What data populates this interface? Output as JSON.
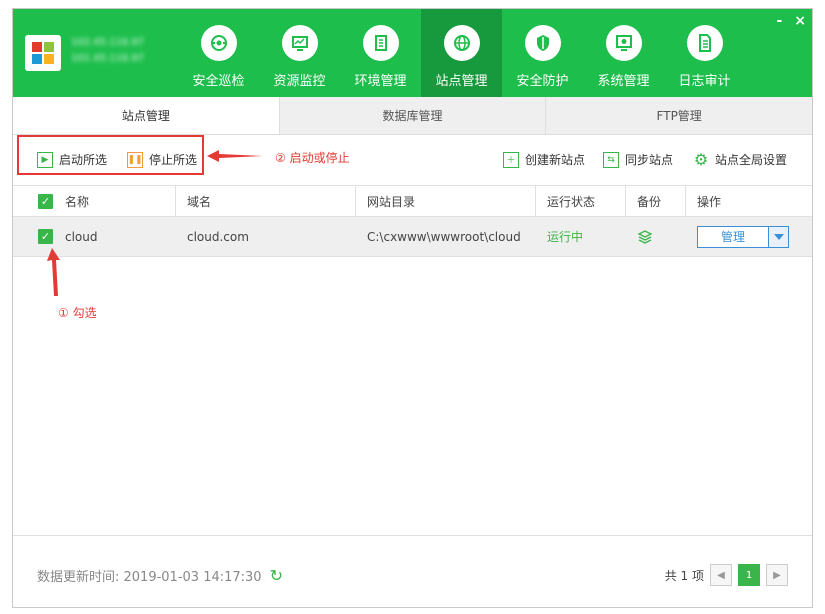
{
  "window": {
    "minimize_label": "-",
    "close_label": "×",
    "server_lines": [
      "102.45.116.97",
      "101.45.116.97"
    ]
  },
  "nav": [
    {
      "label": "安全巡检",
      "icon": "shield-scan-icon"
    },
    {
      "label": "资源监控",
      "icon": "monitor-chart-icon"
    },
    {
      "label": "环境管理",
      "icon": "server-stack-icon"
    },
    {
      "label": "站点管理",
      "icon": "globe-icon",
      "active": true
    },
    {
      "label": "安全防护",
      "icon": "shield-icon"
    },
    {
      "label": "系统管理",
      "icon": "gear-screen-icon"
    },
    {
      "label": "日志审计",
      "icon": "document-icon"
    }
  ],
  "tabs": [
    "站点管理",
    "数据库管理",
    "FTP管理"
  ],
  "toolbar": {
    "start_selected": "启动所选",
    "stop_selected": "停止所选",
    "create_site": "创建新站点",
    "sync_sites": "同步站点",
    "global_settings": "站点全局设置"
  },
  "annotations": {
    "step2": "② 启动或停止",
    "step1": "① 勾选"
  },
  "table": {
    "headers": [
      "名称",
      "域名",
      "网站目录",
      "运行状态",
      "备份",
      "操作"
    ],
    "rows": [
      {
        "name": "cloud",
        "domain": "cloud.com",
        "dir": "C:\\cxwww\\wwwroot\\cloud",
        "status": "运行中",
        "action": "管理"
      }
    ]
  },
  "footer": {
    "update_time": "数据更新时间: 2019-01-03 14:17:30",
    "total": "共 1 项",
    "current_page": "1"
  },
  "colors": {
    "brand_green": "#1dbe4c",
    "accent_green": "#3ab54a",
    "annotation_red": "#e53935",
    "link_blue": "#3a8fd8"
  }
}
